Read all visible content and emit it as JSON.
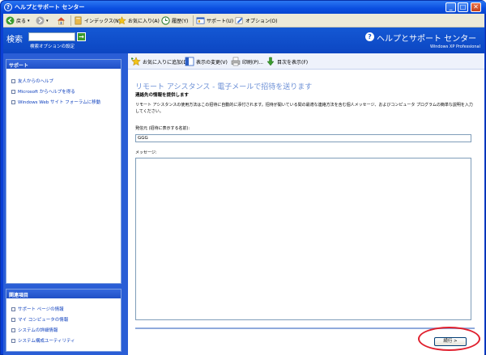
{
  "window": {
    "title": "ヘルプとサポート センター",
    "minimize": "_",
    "maximize": "□",
    "close": "✕"
  },
  "toolbar": {
    "back": "戻る",
    "index": "インデックス(N)",
    "favorites": "お気に入り(A)",
    "history": "履歴(Y)",
    "support": "サポート(U)",
    "options": "オプション(O)"
  },
  "header": {
    "search_label": "検索",
    "search_value": "",
    "search_go": "→",
    "search_options": "検索オプションの設定",
    "help_glyph": "?",
    "title": "ヘルプとサポート センター",
    "subtitle": "Windows XP Professional"
  },
  "support_panel": {
    "heading": "サポート",
    "items": [
      {
        "label": "友人からのヘルプ"
      },
      {
        "label": "Microsoft からヘルプを得る"
      },
      {
        "label": "Windows Web サイト フォーラムに移動"
      }
    ]
  },
  "related_panel": {
    "heading": "関連項目",
    "items": [
      {
        "label": "サポート ページの情報"
      },
      {
        "label": "マイ コンピュータの情報"
      },
      {
        "label": "システムの詳細情報"
      },
      {
        "label": "システム構成ユーティリティ"
      }
    ]
  },
  "main_toolbar": {
    "add_favorite": "お気に入りに追加(D)",
    "change_view": "表示の変更(V)",
    "print": "印刷(P)...",
    "find_toc": "目次を表示(F)"
  },
  "content": {
    "title": "リモート アシスタンス - 電子メールで招待を送ります",
    "subtitle": "連絡先の情報を提供します",
    "description": "リモート アシスタンスの使用方法はこの招待に自動的に添付されます。招待が開いている間の最適な連絡方法を含む個人メッセージ、およびコンピュータ プログラムの簡単な説明を入力してください。",
    "from_label": "発信元 (招待に表示する名前):",
    "from_value": "GGG",
    "message_label": "メッセージ:",
    "message_value": "",
    "next_button": "続行 >"
  },
  "colors": {
    "title_bar": "#0a4ee0",
    "header": "#1458d4",
    "left_panel": "#2a5ed6",
    "highlight_ring": "#e0202e",
    "link": "#0a3dbd"
  }
}
